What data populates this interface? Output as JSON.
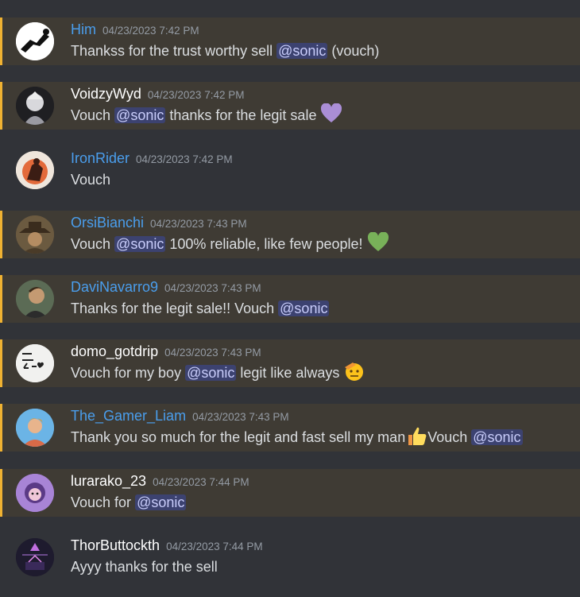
{
  "colors": {
    "background": "#313338",
    "mention_highlight": "#3f3b34",
    "mention_bar": "#f0b232",
    "mention_pill_bg": "#3c4270",
    "mention_pill_text": "#c9cdfb",
    "timestamp": "#949ba4",
    "message_text": "#dbdee1"
  },
  "messages": [
    {
      "username": "Him",
      "username_color": "#4a9eed",
      "timestamp": "04/23/2023 7:42 PM",
      "before": "Thankss for the trust worthy sell ",
      "mention": "@sonic",
      "after": " (vouch)",
      "emoji": "",
      "after2": "",
      "highlighted": true
    },
    {
      "username": "VoidzyWyd",
      "username_color": "#ffffff",
      "timestamp": "04/23/2023 7:42 PM",
      "before": "Vouch ",
      "mention": "@sonic",
      "after": " thanks for the legit sale ",
      "emoji": "purple-heart",
      "after2": "",
      "highlighted": true
    },
    {
      "username": "IronRider",
      "username_color": "#4a9eed",
      "timestamp": "04/23/2023 7:42 PM",
      "before": "Vouch",
      "mention": "",
      "after": "",
      "emoji": "",
      "after2": "",
      "highlighted": false
    },
    {
      "username": "OrsiBianchi",
      "username_color": "#4a9eed",
      "timestamp": "04/23/2023 7:43 PM",
      "before": "Vouch ",
      "mention": "@sonic",
      "after": "  100% reliable, like few people! ",
      "emoji": "green-heart",
      "after2": "",
      "highlighted": true
    },
    {
      "username": "DaviNavarro9",
      "username_color": "#4a9eed",
      "timestamp": "04/23/2023 7:43 PM",
      "before": "Thanks for the legit sale!! Vouch ",
      "mention": "@sonic",
      "after": "",
      "emoji": "",
      "after2": "",
      "highlighted": true
    },
    {
      "username": "domo_gotdrip",
      "username_color": "#ffffff",
      "timestamp": "04/23/2023 7:43 PM",
      "before": "Vouch for my boy ",
      "mention": "@sonic",
      "after": " legit like always ",
      "emoji": "saluting-face",
      "after2": "",
      "highlighted": true
    },
    {
      "username": "The_Gamer_Liam",
      "username_color": "#4a9eed",
      "timestamp": "04/23/2023 7:43 PM",
      "before": "Thank you so much for the legit and fast sell my man",
      "mention": "@sonic",
      "after": "",
      "emoji": "thumbs-up",
      "after2": "Vouch ",
      "highlighted": true
    },
    {
      "username": "lurarako_23",
      "username_color": "#ffffff",
      "timestamp": "04/23/2023 7:44 PM",
      "before": "Vouch for ",
      "mention": "@sonic",
      "after": "",
      "emoji": "",
      "after2": "",
      "highlighted": true
    },
    {
      "username": "ThorButtockth",
      "username_color": "#ffffff",
      "timestamp": "04/23/2023 7:44 PM",
      "before": "Ayyy thanks for the sell",
      "mention": "",
      "after": "",
      "emoji": "",
      "after2": "",
      "highlighted": false
    }
  ]
}
